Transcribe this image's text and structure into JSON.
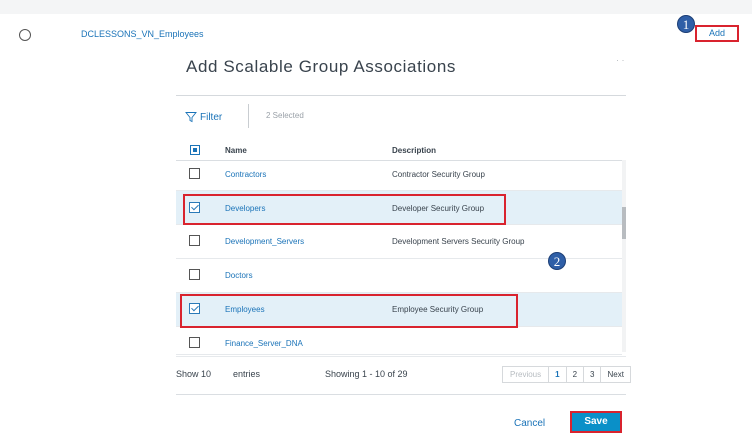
{
  "vn_row": {
    "name": "DCLESSONS_VN_Employees",
    "add_label": "Add"
  },
  "badges": {
    "one": "1",
    "two": "2"
  },
  "modal": {
    "title": "Add Scalable Group Associations",
    "close_glyph": "· ·",
    "filter_label": "Filter",
    "selected_count": "2 Selected",
    "columns": {
      "name": "Name",
      "description": "Description"
    },
    "rows": [
      {
        "name": "Contractors",
        "description": "Contractor Security Group",
        "selected": false
      },
      {
        "name": "Developers",
        "description": "Developer Security Group",
        "selected": true
      },
      {
        "name": "Development_Servers",
        "description": "Development Servers Security Group",
        "selected": false
      },
      {
        "name": "Doctors",
        "description": "",
        "selected": false
      },
      {
        "name": "Employees",
        "description": "Employee Security Group",
        "selected": true
      },
      {
        "name": "Finance_Server_DNA",
        "description": "",
        "selected": false
      }
    ],
    "footer": {
      "show_label": "Show 10",
      "entries_label": "entries",
      "showing": "Showing 1 - 10 of 29",
      "pager": {
        "previous": "Previous",
        "pages": [
          "1",
          "2",
          "3"
        ],
        "next": "Next",
        "active": "1"
      }
    },
    "cancel_label": "Cancel",
    "save_label": "Save"
  },
  "icons": {
    "filter": "funnel-icon",
    "radio": "radio-unchecked",
    "checkbox": "checkbox"
  },
  "colors": {
    "link": "#1a73b8",
    "primary_button": "#0a90c8",
    "highlight": "#d9232e",
    "badge": "#2f5fa7",
    "row_selected": "#e3f0f8"
  }
}
